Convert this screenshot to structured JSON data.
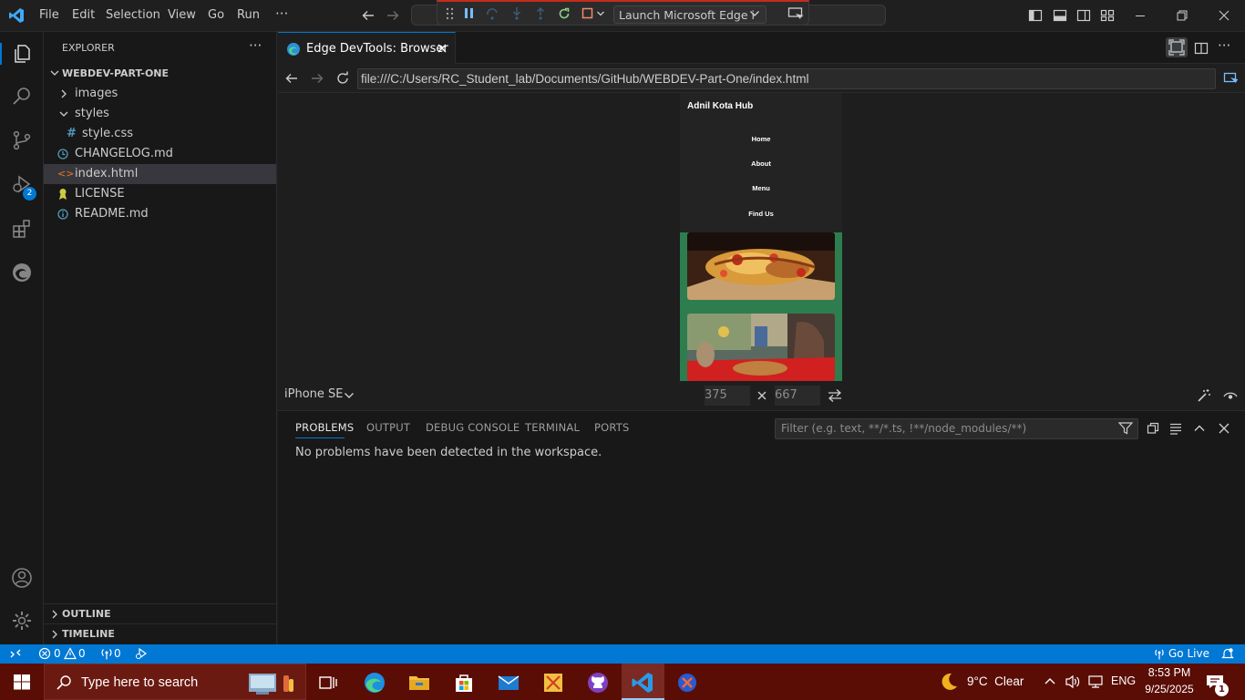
{
  "menu": {
    "items": [
      "File",
      "Edit",
      "Selection",
      "View",
      "Go",
      "Run",
      "···"
    ]
  },
  "debug": {
    "config_label": "Launch Microsoft Edge i"
  },
  "explorer": {
    "title": "EXPLORER",
    "project": "WEBDEV-PART-ONE",
    "items": [
      {
        "label": "images"
      },
      {
        "label": "styles"
      },
      {
        "label": "style.css"
      },
      {
        "label": "CHANGELOG.md"
      },
      {
        "label": "index.html"
      },
      {
        "label": "LICENSE"
      },
      {
        "label": "README.md"
      }
    ],
    "outline": "OUTLINE",
    "timeline": "TIMELINE"
  },
  "activity": {
    "run_badge": "2"
  },
  "editor": {
    "tab_label": "Edge DevTools: Browser",
    "url": "file:///C:/Users/RC_Student_lab/Documents/GitHub/WEBDEV-Part-One/index.html",
    "device": "iPhone SE",
    "width": "375",
    "height": "667"
  },
  "site": {
    "brand": "Adnil Kota Hub",
    "nav": [
      "Home",
      "About",
      "Menu",
      "Find Us"
    ],
    "accent": "#2e7d4f"
  },
  "panel": {
    "tabs": [
      "PROBLEMS",
      "OUTPUT",
      "DEBUG CONSOLE",
      "TERMINAL",
      "PORTS"
    ],
    "filter_placeholder": "Filter (e.g. text, **/*.ts, !**/node_modules/**)",
    "message": "No problems have been detected in the workspace."
  },
  "status": {
    "errors": "0",
    "warnings": "0",
    "ports": "0",
    "go_live": "Go Live",
    "color": "#0078d4"
  },
  "taskbar": {
    "search_placeholder": "Type here to search",
    "weather": "9°C  Clear",
    "lang": "ENG",
    "time": "8:53 PM",
    "date": "9/25/2025",
    "notif_count": "1",
    "color": "#5a0d05"
  }
}
